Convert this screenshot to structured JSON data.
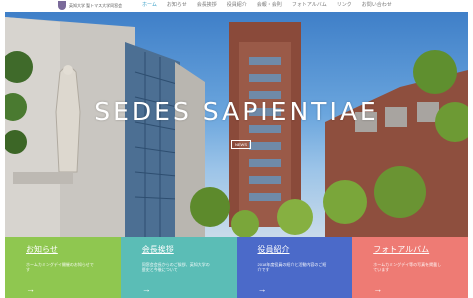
{
  "header": {
    "logo_text": "英知大学 聖トマス大学同窓会",
    "nav": [
      "ホーム",
      "お知らせ",
      "会長挨拶",
      "役員紹介",
      "会報・会則",
      "フォトアルバム",
      "リンク",
      "お問い合わせ"
    ]
  },
  "hero": {
    "title": "SEDES SAPIENTIAE",
    "button_label": "NEWS"
  },
  "cards": [
    {
      "title": "お知らせ",
      "desc": "ホームカミングデイ開催のお知らせです",
      "arrow": "→",
      "color": "#8fc750"
    },
    {
      "title": "会長挨拶",
      "desc": "同窓会会長からのご挨拶、英知大学の歴史と今後について",
      "arrow": "→",
      "color": "#5bbdb6"
    },
    {
      "title": "役員紹介",
      "desc": "2018年度役員の紹介と活動内容のご紹介です",
      "arrow": "→",
      "color": "#4b6ac9"
    },
    {
      "title": "フォトアルバム",
      "desc": "ホームカミングデイ等の写真を掲載しています",
      "arrow": "→",
      "color": "#ee7b74"
    }
  ],
  "colors": {
    "accent": "#3aa0c8"
  },
  "icons": {
    "crest": "school-crest-icon",
    "arrow": "arrow-right-icon"
  }
}
